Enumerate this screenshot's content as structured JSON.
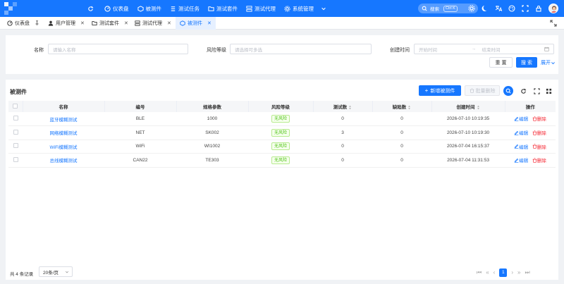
{
  "colors": {
    "brand": "#1677ff",
    "danger": "#f5222d",
    "success": "#52c41a"
  },
  "nav": [
    {
      "icon": "refresh-icon",
      "label": ""
    },
    {
      "icon": "dashboard-icon",
      "label": "仪表盘"
    },
    {
      "icon": "cube-icon",
      "label": "被测件"
    },
    {
      "icon": "list-icon",
      "label": "测试任务"
    },
    {
      "icon": "folder-icon",
      "label": "测试套件"
    },
    {
      "icon": "server-icon",
      "label": "测试代理"
    },
    {
      "icon": "gear-icon",
      "label": "系统管理"
    }
  ],
  "search": {
    "label": "搜索",
    "shortcut": "Ctrl K"
  },
  "tabs": [
    {
      "label": "仪表盘",
      "icon": "dashboard-icon"
    },
    {
      "label": "用户管理",
      "icon": "user-icon"
    },
    {
      "label": "测试套件",
      "icon": "folder-icon"
    },
    {
      "label": "测试代理",
      "icon": "server-icon"
    },
    {
      "label": "被测件",
      "icon": "cube-icon"
    }
  ],
  "filters": {
    "name_label": "名称",
    "name_placeholder": "请输入名称",
    "risk_label": "风险等级",
    "risk_placeholder": "请选择可多选",
    "created_label": "创建时间",
    "start_placeholder": "开始时间",
    "range_sep": "→",
    "end_placeholder": "结束时间",
    "reset": "重 置",
    "search": "搜 索",
    "expand": "展开"
  },
  "table": {
    "title": "被测件",
    "add_button": "新增被测件",
    "batch_delete": "批量删除",
    "columns": [
      "名称",
      "编号",
      "规格参数",
      "风险等级",
      "测试数",
      "缺陷数",
      "创建时间",
      "操作"
    ],
    "rows": [
      {
        "name": "蓝牙模糊测试",
        "code": "BLE",
        "spec": "1000",
        "risk": "无风险",
        "tests": "0",
        "defects": "0",
        "created": "2026-07-10 10:19:35"
      },
      {
        "name": "网络模糊测试",
        "code": "NET",
        "spec": "SK002",
        "risk": "无风险",
        "tests": "3",
        "defects": "0",
        "created": "2026-07-10 10:19:30"
      },
      {
        "name": "WiFi模糊测试",
        "code": "WiFi",
        "spec": "WI1002",
        "risk": "无风险",
        "tests": "0",
        "defects": "0",
        "created": "2026-07-04 16:15:37"
      },
      {
        "name": "总线模糊测试",
        "code": "CAN22",
        "spec": "TE303",
        "risk": "无风险",
        "tests": "0",
        "defects": "0",
        "created": "2026-07-04 11:31:53"
      }
    ],
    "edit_label": "编辑",
    "delete_label": "删除"
  },
  "footer": {
    "total": "共 4 条记录",
    "page_size": "20条/页",
    "current_page": "1"
  }
}
